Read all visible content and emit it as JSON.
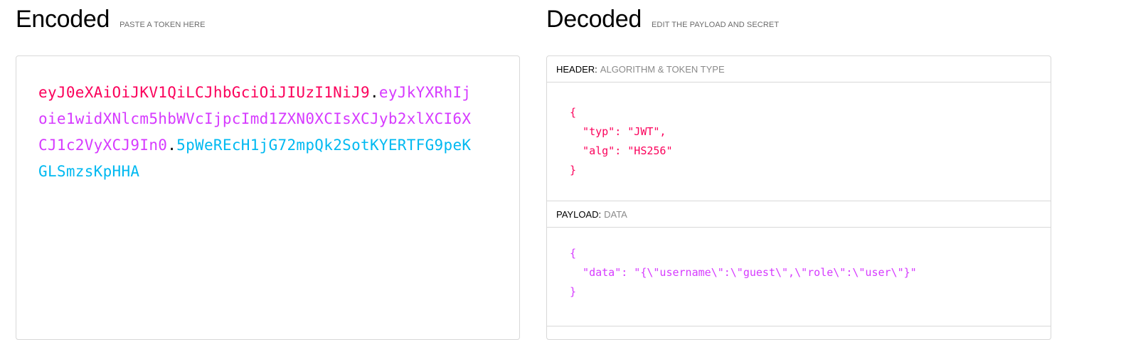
{
  "encoded": {
    "title": "Encoded",
    "subtitle": "PASTE A TOKEN HERE",
    "token": {
      "header": "eyJ0eXAiOiJKV1QiLCJhbGciOiJIUzI1NiJ9",
      "payload": "eyJkYXRhIjoie1widXNlcm5hbWVcIjpcImd1ZXN0XCIsXCJyb2xlXCI6XCJ1c2VyXCJ9In0",
      "signature": "5pWeREcH1jG72mpQk2SotKYERTFG9peKGLSmzsKpHHA",
      "separator": "."
    }
  },
  "decoded": {
    "title": "Decoded",
    "subtitle": "EDIT THE PAYLOAD AND SECRET",
    "header_section": {
      "label": "HEADER:",
      "desc": "ALGORITHM & TOKEN TYPE",
      "json": "{\n  \"typ\": \"JWT\",\n  \"alg\": \"HS256\"\n}"
    },
    "payload_section": {
      "label": "PAYLOAD:",
      "desc": "DATA",
      "json": "{\n  \"data\": \"{\\\"username\\\":\\\"guest\\\",\\\"role\\\":\\\"user\\\"}\"\n}"
    }
  },
  "colors": {
    "header": "#fb015b",
    "payload": "#d63aff",
    "signature": "#00b9f1"
  }
}
